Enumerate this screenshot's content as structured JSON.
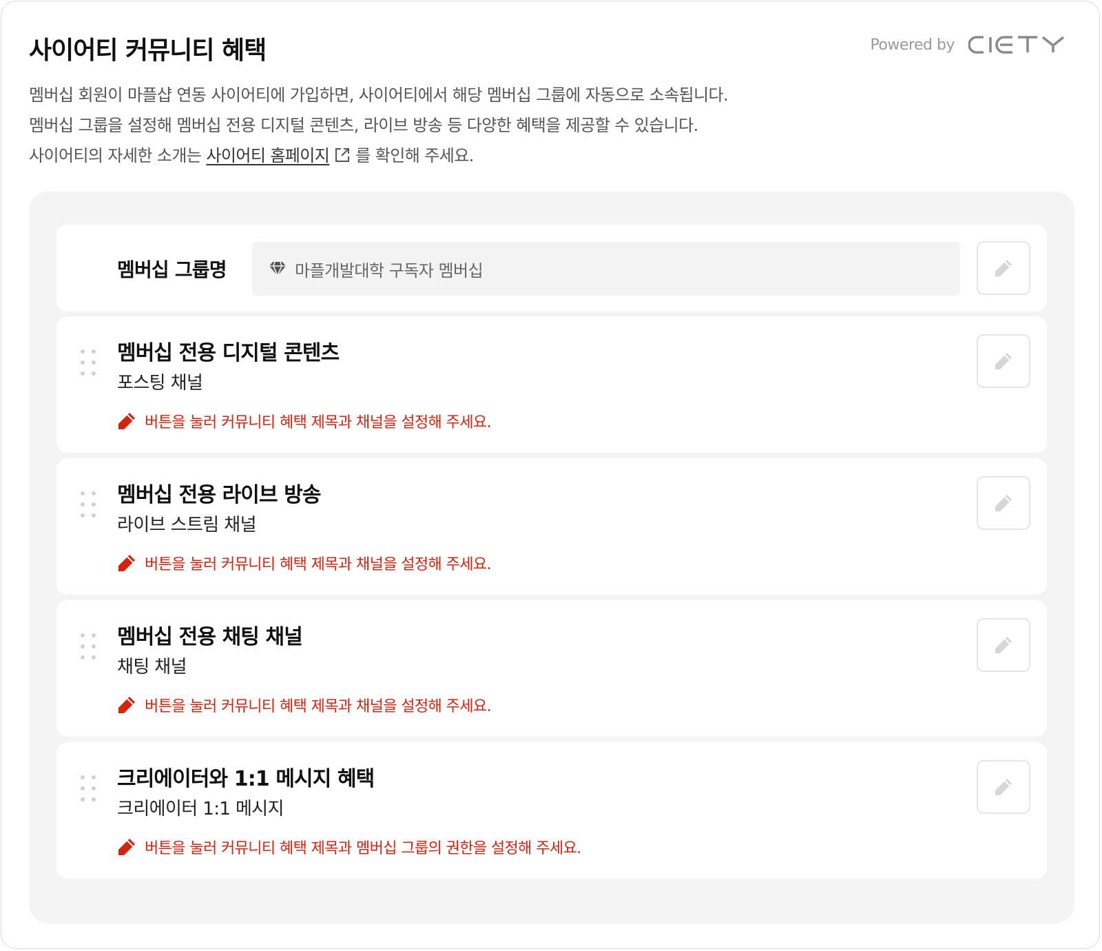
{
  "header": {
    "title": "사이어티 커뮤니티 혜택",
    "powered_by": "Powered by",
    "brand_logo": "CICTY"
  },
  "description": {
    "line1": "멤버십 회원이 마플샵 연동 사이어티에 가입하면, 사이어티에서 해당 멤버십 그룹에 자동으로 소속됩니다.",
    "line2": "멤버십 그룹을 설정해 멤버십 전용 디지털 콘텐츠, 라이브 방송 등 다양한 혜택을 제공할 수 있습니다.",
    "line3_prefix": "사이어티의 자세한 소개는 ",
    "line3_link": "사이어티 홈페이지",
    "line3_suffix": "를 확인해 주세요."
  },
  "group": {
    "label": "멤버십 그룹명",
    "icon": "diamond-icon",
    "value": "마플개발대학 구독자 멤버십"
  },
  "benefits": [
    {
      "title": "멤버십 전용 디지털 콘텐츠",
      "subtitle": "포스팅 채널",
      "warning": "버튼을 눌러 커뮤니티 혜택 제목과 채널을 설정해 주세요."
    },
    {
      "title": "멤버십 전용 라이브 방송",
      "subtitle": "라이브 스트림 채널",
      "warning": "버튼을 눌러 커뮤니티 혜택 제목과 채널을 설정해 주세요."
    },
    {
      "title": "멤버십 전용 채팅 채널",
      "subtitle": "채팅 채널",
      "warning": "버튼을 눌러 커뮤니티 혜택 제목과 채널을 설정해 주세요."
    },
    {
      "title": "크리에이터와 1:1 메시지 혜택",
      "subtitle": "크리에이터 1:1 메시지",
      "warning": "버튼을 눌러 커뮤니티 혜택 제목과 멤버십 그룹의 권한을 설정해 주세요."
    }
  ],
  "colors": {
    "warning": "#d4230f",
    "panel_bg": "#f4f4f4",
    "field_bg": "#f3f3f3"
  }
}
